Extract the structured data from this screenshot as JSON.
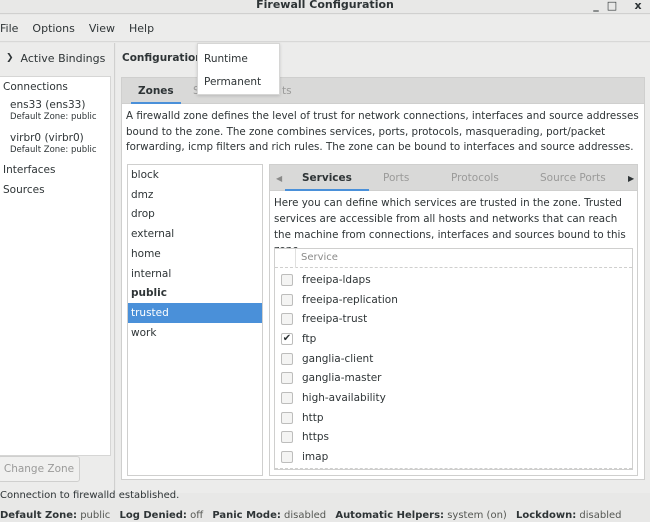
{
  "window": {
    "title": "Firewall Configuration",
    "controls": {
      "minimize": "_",
      "maximize": "□",
      "close": "x"
    }
  },
  "menubar": [
    "File",
    "Options",
    "View",
    "Help"
  ],
  "sidebar": {
    "header": "Active Bindings",
    "header_icon": "chevron-down-icon",
    "sections": {
      "connections": "Connections",
      "interfaces": "Interfaces",
      "sources": "Sources"
    },
    "connections": [
      {
        "name": "ens33 (ens33)",
        "zone": "Default Zone: public"
      },
      {
        "name": "virbr0 (virbr0)",
        "zone": "Default Zone: public"
      }
    ],
    "change_zone_button": "Change Zone"
  },
  "configuration": {
    "label": "Configuration:",
    "dropdown_options": [
      "Runtime",
      "Permanent"
    ]
  },
  "outer_tabs": [
    {
      "label": "Zones",
      "active": true
    },
    {
      "label": "S",
      "active": false
    },
    {
      "label": "ts",
      "active": false
    }
  ],
  "zone_description": "A firewalld zone defines the level of trust for network connections, interfaces and source addresses bound to the zone. The zone combines services, ports, protocols, masquerading, port/packet forwarding, icmp filters and rich rules. The zone can be bound to interfaces and source addresses.",
  "zones": [
    {
      "name": "block"
    },
    {
      "name": "dmz"
    },
    {
      "name": "drop"
    },
    {
      "name": "external"
    },
    {
      "name": "home"
    },
    {
      "name": "internal"
    },
    {
      "name": "public",
      "default": true
    },
    {
      "name": "trusted",
      "selected": true
    },
    {
      "name": "work"
    }
  ],
  "inner_tabs": [
    {
      "label": "Services",
      "active": true
    },
    {
      "label": "Ports",
      "active": false
    },
    {
      "label": "Protocols",
      "active": false
    },
    {
      "label": "Source Ports",
      "active": false
    }
  ],
  "services_description": "Here you can define which services are trusted in the zone. Trusted services are accessible from all hosts and networks that can reach the machine from connections, interfaces and sources bound to this zone.",
  "service_table": {
    "header": "Service",
    "rows": [
      {
        "name": "freeipa-ldaps",
        "checked": false
      },
      {
        "name": "freeipa-replication",
        "checked": false
      },
      {
        "name": "freeipa-trust",
        "checked": false
      },
      {
        "name": "ftp",
        "checked": true
      },
      {
        "name": "ganglia-client",
        "checked": false
      },
      {
        "name": "ganglia-master",
        "checked": false
      },
      {
        "name": "high-availability",
        "checked": false
      },
      {
        "name": "http",
        "checked": false
      },
      {
        "name": "https",
        "checked": false
      },
      {
        "name": "imap",
        "checked": false
      }
    ]
  },
  "status": {
    "message": "Connection to firewalld established.",
    "fields": [
      {
        "label": "Default Zone:",
        "value": "public"
      },
      {
        "label": "Log Denied:",
        "value": "off"
      },
      {
        "label": "Panic Mode:",
        "value": "disabled"
      },
      {
        "label": "Automatic Helpers:",
        "value": "system (on)"
      },
      {
        "label": "Lockdown:",
        "value": "disabled"
      }
    ]
  },
  "colors": {
    "accent": "#4a90d9",
    "selection_text": "#ffffff",
    "tab_bar": "#d9d9d8"
  }
}
